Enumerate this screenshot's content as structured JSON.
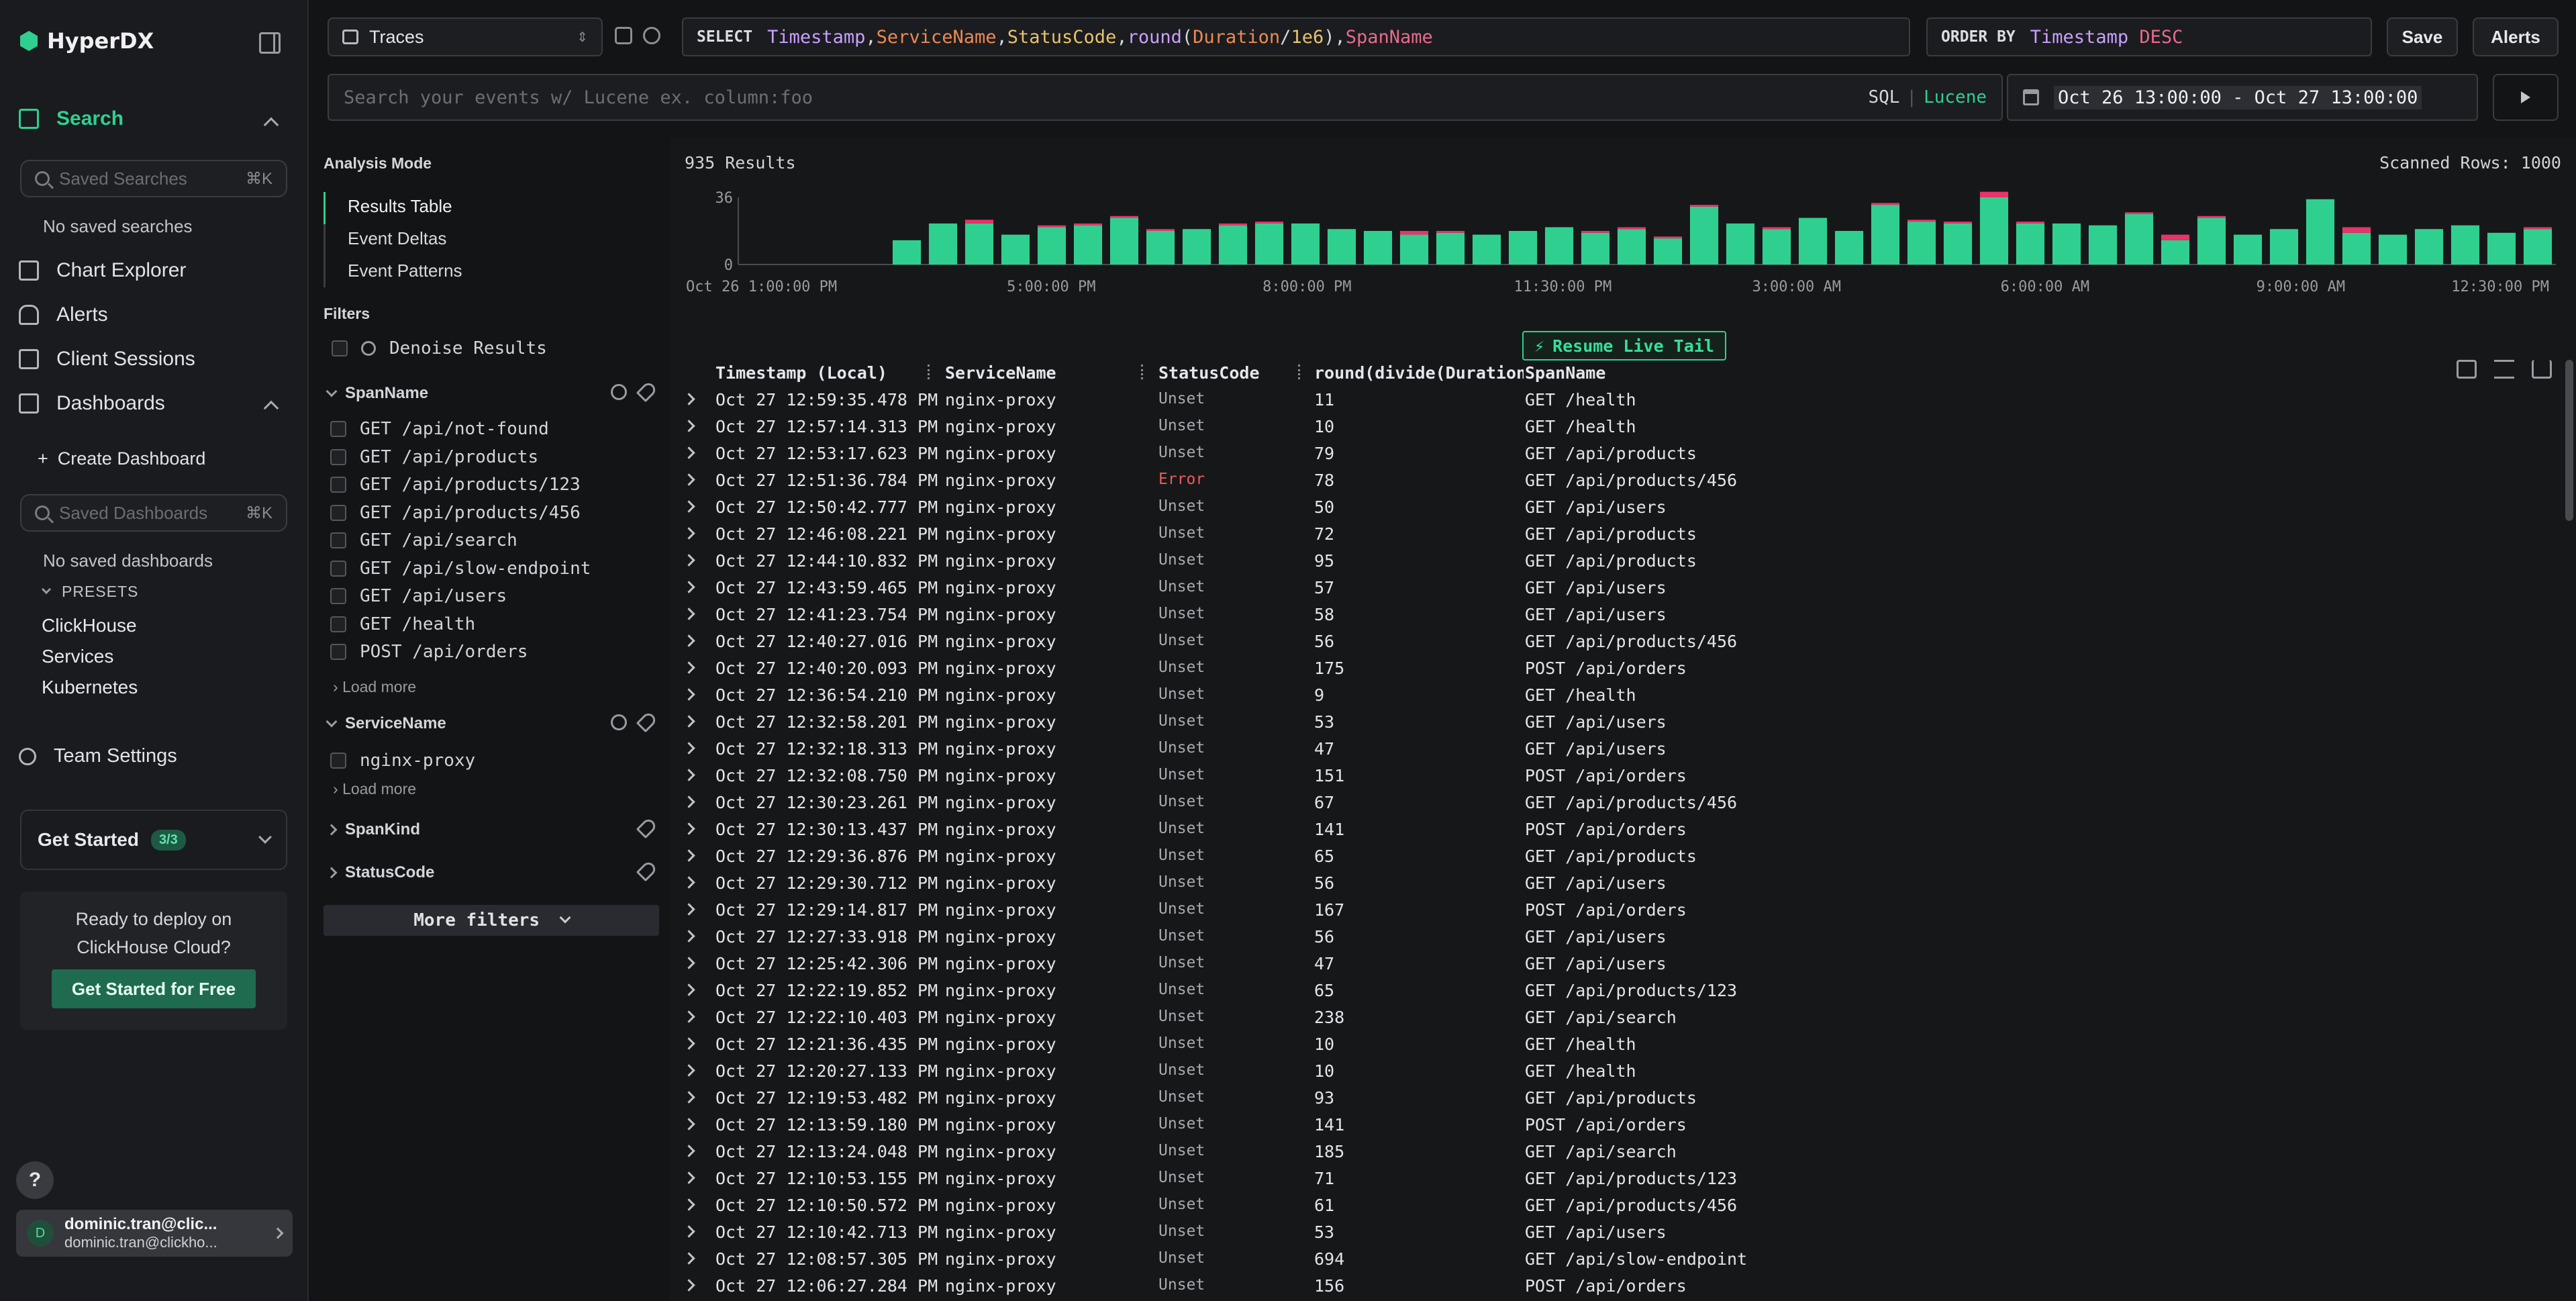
{
  "app": {
    "name": "HyperDX"
  },
  "sidebar": {
    "search_label": "Search",
    "saved_searches_placeholder": "Saved Searches",
    "saved_searches_kbd": "⌘K",
    "no_saved_searches": "No saved searches",
    "chart_explorer": "Chart Explorer",
    "alerts": "Alerts",
    "client_sessions": "Client Sessions",
    "dashboards": "Dashboards",
    "create_dashboard": "Create Dashboard",
    "saved_dashboards_placeholder": "Saved Dashboards",
    "saved_dashboards_kbd": "⌘K",
    "no_saved_dashboards": "No saved dashboards",
    "presets_label": "PRESETS",
    "presets": [
      "ClickHouse",
      "Services",
      "Kubernetes"
    ],
    "team_settings": "Team Settings",
    "get_started": "Get Started",
    "get_started_badge": "3/3",
    "deploy_line1": "Ready to deploy on",
    "deploy_line2": "ClickHouse Cloud?",
    "deploy_button": "Get Started for Free",
    "help": "?",
    "user_initial": "D",
    "user_name": "dominic.tran@clic...",
    "user_email": "dominic.tran@clickho..."
  },
  "topbar": {
    "source": "Traces",
    "select_kw": "SELECT",
    "order_kw": "ORDER BY",
    "order_col": "Timestamp",
    "order_dir": "DESC",
    "save": "Save",
    "alerts": "Alerts",
    "search_placeholder": "Search your events w/ Lucene ex. column:foo",
    "lang_sql": "SQL",
    "lang_sep": "|",
    "lang_lucene": "Lucene",
    "date_range": "Oct 26 13:00:00 - Oct 27 13:00:00"
  },
  "filters": {
    "analysis_mode": "Analysis Mode",
    "modes": [
      "Results Table",
      "Event Deltas",
      "Event Patterns"
    ],
    "filters_title": "Filters",
    "denoise": "Denoise Results",
    "spanname_title": "SpanName",
    "spannames": [
      "GET /api/not-found",
      "GET /api/products",
      "GET /api/products/123",
      "GET /api/products/456",
      "GET /api/search",
      "GET /api/slow-endpoint",
      "GET /api/users",
      "GET /health",
      "POST /api/orders"
    ],
    "load_more": "Load more",
    "servicename_title": "ServiceName",
    "servicenames": [
      "nginx-proxy"
    ],
    "spankind_title": "SpanKind",
    "statuscode_title": "StatusCode",
    "more_filters": "More filters"
  },
  "results": {
    "count": "935 Results",
    "scanned": "Scanned Rows: 1000",
    "live_tail": "Resume Live Tail",
    "columns": [
      "Timestamp (Local)",
      "ServiceName",
      "StatusCode",
      "round(divide(Duration,",
      "SpanName"
    ]
  },
  "chart_data": {
    "type": "bar",
    "y_ticks": [
      "36",
      "0"
    ],
    "ylim": [
      0,
      36
    ],
    "x_tick_labels": [
      "Oct 26 1:00:00 PM",
      "5:00:00 PM",
      "8:00:00 PM",
      "11:30:00 PM",
      "3:00:00 AM",
      "6:00:00 AM",
      "9:00:00 AM",
      "12:30:00 PM"
    ],
    "series": [
      {
        "color": "#2fd08f",
        "values": [
          0,
          0,
          0,
          0,
          13,
          22,
          22,
          16,
          20,
          21,
          25,
          18,
          19,
          21,
          22,
          22,
          19,
          18,
          16,
          17,
          16,
          18,
          20,
          17,
          19,
          14,
          31,
          22,
          19,
          25,
          18,
          32,
          23,
          22,
          36,
          22,
          22,
          21,
          27,
          13,
          25,
          16,
          19,
          35,
          17,
          16,
          19,
          21,
          17,
          19
        ]
      },
      {
        "color": "#e8336b",
        "values": [
          0,
          0,
          0,
          0,
          0,
          0,
          2,
          0,
          1,
          1,
          1,
          1,
          0,
          1,
          1,
          0,
          0,
          0,
          2,
          1,
          0,
          0,
          0,
          1,
          1,
          1,
          1,
          0,
          1,
          0,
          0,
          1,
          1,
          1,
          3,
          1,
          0,
          0,
          1,
          3,
          1,
          0,
          0,
          0,
          3,
          0,
          0,
          0,
          0,
          1
        ]
      }
    ]
  },
  "table": {
    "status_colors": {
      "Unset": "#a9aaaf",
      "Error": "#ef5a5a"
    },
    "rows": [
      [
        "Oct 27 12:59:35.478 PM",
        "nginx-proxy",
        "Unset",
        "11",
        "GET /health"
      ],
      [
        "Oct 27 12:57:14.313 PM",
        "nginx-proxy",
        "Unset",
        "10",
        "GET /health"
      ],
      [
        "Oct 27 12:53:17.623 PM",
        "nginx-proxy",
        "Unset",
        "79",
        "GET /api/products"
      ],
      [
        "Oct 27 12:51:36.784 PM",
        "nginx-proxy",
        "Error",
        "78",
        "GET /api/products/456"
      ],
      [
        "Oct 27 12:50:42.777 PM",
        "nginx-proxy",
        "Unset",
        "50",
        "GET /api/users"
      ],
      [
        "Oct 27 12:46:08.221 PM",
        "nginx-proxy",
        "Unset",
        "72",
        "GET /api/products"
      ],
      [
        "Oct 27 12:44:10.832 PM",
        "nginx-proxy",
        "Unset",
        "95",
        "GET /api/products"
      ],
      [
        "Oct 27 12:43:59.465 PM",
        "nginx-proxy",
        "Unset",
        "57",
        "GET /api/users"
      ],
      [
        "Oct 27 12:41:23.754 PM",
        "nginx-proxy",
        "Unset",
        "58",
        "GET /api/users"
      ],
      [
        "Oct 27 12:40:27.016 PM",
        "nginx-proxy",
        "Unset",
        "56",
        "GET /api/products/456"
      ],
      [
        "Oct 27 12:40:20.093 PM",
        "nginx-proxy",
        "Unset",
        "175",
        "POST /api/orders"
      ],
      [
        "Oct 27 12:36:54.210 PM",
        "nginx-proxy",
        "Unset",
        "9",
        "GET /health"
      ],
      [
        "Oct 27 12:32:58.201 PM",
        "nginx-proxy",
        "Unset",
        "53",
        "GET /api/users"
      ],
      [
        "Oct 27 12:32:18.313 PM",
        "nginx-proxy",
        "Unset",
        "47",
        "GET /api/users"
      ],
      [
        "Oct 27 12:32:08.750 PM",
        "nginx-proxy",
        "Unset",
        "151",
        "POST /api/orders"
      ],
      [
        "Oct 27 12:30:23.261 PM",
        "nginx-proxy",
        "Unset",
        "67",
        "GET /api/products/456"
      ],
      [
        "Oct 27 12:30:13.437 PM",
        "nginx-proxy",
        "Unset",
        "141",
        "POST /api/orders"
      ],
      [
        "Oct 27 12:29:36.876 PM",
        "nginx-proxy",
        "Unset",
        "65",
        "GET /api/products"
      ],
      [
        "Oct 27 12:29:30.712 PM",
        "nginx-proxy",
        "Unset",
        "56",
        "GET /api/users"
      ],
      [
        "Oct 27 12:29:14.817 PM",
        "nginx-proxy",
        "Unset",
        "167",
        "POST /api/orders"
      ],
      [
        "Oct 27 12:27:33.918 PM",
        "nginx-proxy",
        "Unset",
        "56",
        "GET /api/users"
      ],
      [
        "Oct 27 12:25:42.306 PM",
        "nginx-proxy",
        "Unset",
        "47",
        "GET /api/users"
      ],
      [
        "Oct 27 12:22:19.852 PM",
        "nginx-proxy",
        "Unset",
        "65",
        "GET /api/products/123"
      ],
      [
        "Oct 27 12:22:10.403 PM",
        "nginx-proxy",
        "Unset",
        "238",
        "GET /api/search"
      ],
      [
        "Oct 27 12:21:36.435 PM",
        "nginx-proxy",
        "Unset",
        "10",
        "GET /health"
      ],
      [
        "Oct 27 12:20:27.133 PM",
        "nginx-proxy",
        "Unset",
        "10",
        "GET /health"
      ],
      [
        "Oct 27 12:19:53.482 PM",
        "nginx-proxy",
        "Unset",
        "93",
        "GET /api/products"
      ],
      [
        "Oct 27 12:13:59.180 PM",
        "nginx-proxy",
        "Unset",
        "141",
        "POST /api/orders"
      ],
      [
        "Oct 27 12:13:24.048 PM",
        "nginx-proxy",
        "Unset",
        "185",
        "GET /api/search"
      ],
      [
        "Oct 27 12:10:53.155 PM",
        "nginx-proxy",
        "Unset",
        "71",
        "GET /api/products/123"
      ],
      [
        "Oct 27 12:10:50.572 PM",
        "nginx-proxy",
        "Unset",
        "61",
        "GET /api/products/456"
      ],
      [
        "Oct 27 12:10:42.713 PM",
        "nginx-proxy",
        "Unset",
        "53",
        "GET /api/users"
      ],
      [
        "Oct 27 12:08:57.305 PM",
        "nginx-proxy",
        "Unset",
        "694",
        "GET /api/slow-endpoint"
      ],
      [
        "Oct 27 12:06:27.284 PM",
        "nginx-proxy",
        "Unset",
        "156",
        "POST /api/orders"
      ]
    ]
  }
}
